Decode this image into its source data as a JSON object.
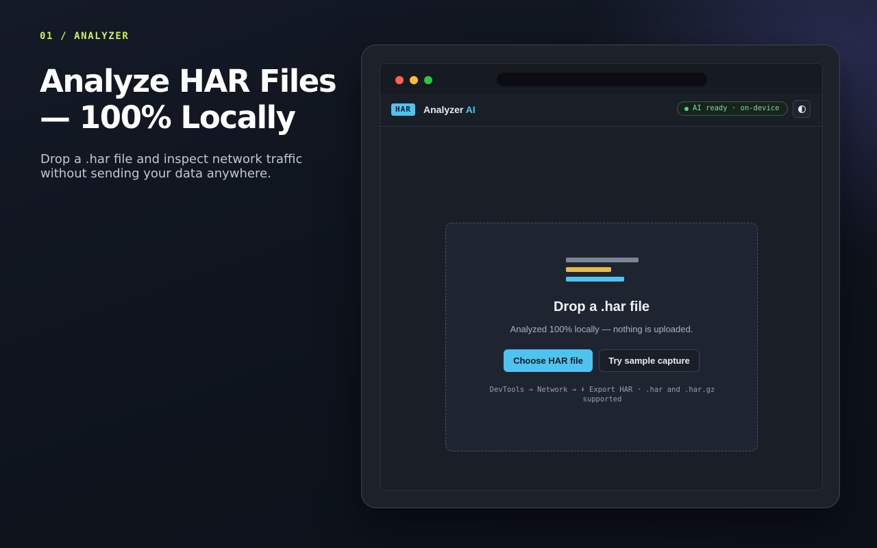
{
  "hero": {
    "eyebrow": "01 / ANALYZER",
    "headline_line1": "Analyze HAR Files",
    "headline_line2": "— 100% Locally",
    "subtitle": "Drop a .har file and inspect network traffic without sending your data anywhere."
  },
  "app": {
    "badge": "HAR",
    "name": "Analyzer",
    "name_accent": "AI",
    "status": "AI ready · on-device",
    "theme_icon": "contrast-icon",
    "colors": {
      "accent": "#4fc3f0",
      "status": "#4ade80",
      "eyebrow": "#c8f060"
    }
  },
  "dropzone": {
    "title": "Drop a .har file",
    "subtitle": "Analyzed 100% locally — nothing is uploaded.",
    "primary_button": "Choose HAR file",
    "secondary_button": "Try sample capture",
    "hint": "DevTools → Network → ⬇ Export HAR · .har and .har.gz supported"
  }
}
